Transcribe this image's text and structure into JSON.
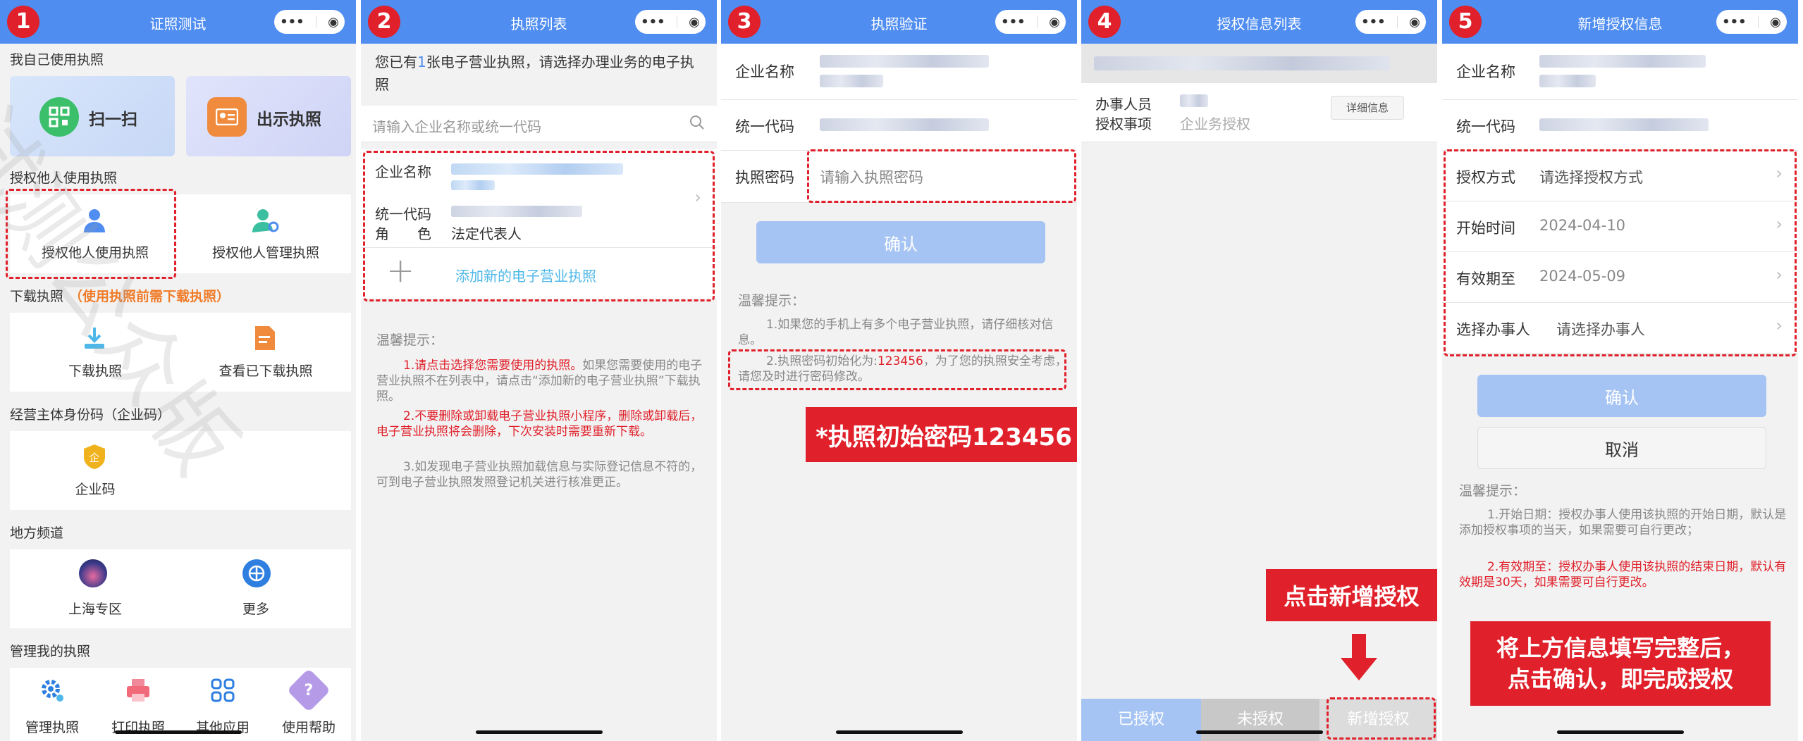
{
  "steps": [
    "1",
    "2",
    "3",
    "4",
    "5"
  ],
  "capsule": {
    "more": "•••",
    "close": "◉"
  },
  "p1": {
    "title": "证照测试",
    "sec_self": "我自己使用执照",
    "scan": "扫一扫",
    "show": "出示执照",
    "sec_auth": "授权他人使用执照",
    "auth_use": "授权他人使用执照",
    "auth_manage": "授权他人管理执照",
    "sec_download": "下载执照",
    "download_note": "（使用执照前需下载执照）",
    "download": "下载执照",
    "view_downloaded": "查看已下载执照",
    "sec_code": "经营主体身份码（企业码）",
    "code": "企业码",
    "sec_local": "地方频道",
    "shanghai": "上海专区",
    "more": "更多",
    "sec_manage": "管理我的执照",
    "manage": "管理执照",
    "print": "打印执照",
    "other": "其他应用",
    "help": "使用帮助",
    "watermark": "试测公众版",
    "code_glyph": "企"
  },
  "p2": {
    "title": "执照列表",
    "notice_a": "您已有",
    "notice_n": "1",
    "notice_b": "张电子营业执照，请选择办理业务的电子执照",
    "search_placeholder": "请输入企业名称或统一代码",
    "company_label": "企业名称",
    "code_label": "统一代码",
    "role_label": "角　　色",
    "role_value": "法定代表人",
    "add": "添加新的电子营业执照",
    "tips_title": "温馨提示：",
    "tip1_num": "1.",
    "tip1_red": "请点击选择您需要使用的执照。",
    "tip1_rest": "如果您需要使用的电子营业执照不在列表中，请点击“添加新的电子营业执照”下载执照。",
    "tip2": "2.不要删除或卸载电子营业执照小程序，删除或卸载后，电子营业执照将会删除，下次安装时需要重新下载。",
    "tip3": "3.如发现电子营业执照加载信息与实际登记信息不符的，可到电子营业执照发照登记机关进行核准更正。"
  },
  "p3": {
    "title": "执照验证",
    "company_label": "企业名称",
    "code_label": "统一代码",
    "pwd_label": "执照密码",
    "pwd_placeholder": "请输入执照密码",
    "confirm": "确认",
    "tips_title": "温馨提示：",
    "tip1": "1.如果您的手机上有多个电子营业执照，请仔细核对信息。",
    "tip2_a": "2.执照密码初始化为:",
    "tip2_red": "123456",
    "tip2_b": "，为了您的执照安全考虑，请您及时进行密码修改。",
    "banner": "*执照初始密码123456"
  },
  "p4": {
    "title": "授权信息列表",
    "agent_label": "办事人员",
    "matter_label": "授权事项",
    "matter_value": "企业务授权",
    "detail": "详细信息",
    "tab_authorized": "已授权",
    "tab_unauthorized": "未授权",
    "tab_new": "新增授权",
    "banner": "点击新增授权"
  },
  "p5": {
    "title": "新增授权信息",
    "company_label": "企业名称",
    "code_label": "统一代码",
    "method_label": "授权方式",
    "method_value": "请选择授权方式",
    "start_label": "开始时间",
    "start_value": "2024-04-10",
    "end_label": "有效期至",
    "end_value": "2024-05-09",
    "agent_label": "选择办事人",
    "agent_value": "请选择办事人",
    "confirm": "确认",
    "cancel": "取消",
    "tips_title": "温馨提示：",
    "tip1": "1.开始日期：授权办事人使用该执照的开始日期，默认是添加授权事项的当天，如果需要可自行更改；",
    "tip2": "2.有效期至：授权办事人使用该执照的结束日期，默认有效期是30天，如果需要可自行更改。",
    "banner_line1": "将上方信息填写完整后，",
    "banner_line2": "点击确认，即完成授权"
  },
  "colors": {
    "nav": "#4f8df0",
    "accent_red": "#e0202a",
    "orange": "#f07c2a"
  }
}
